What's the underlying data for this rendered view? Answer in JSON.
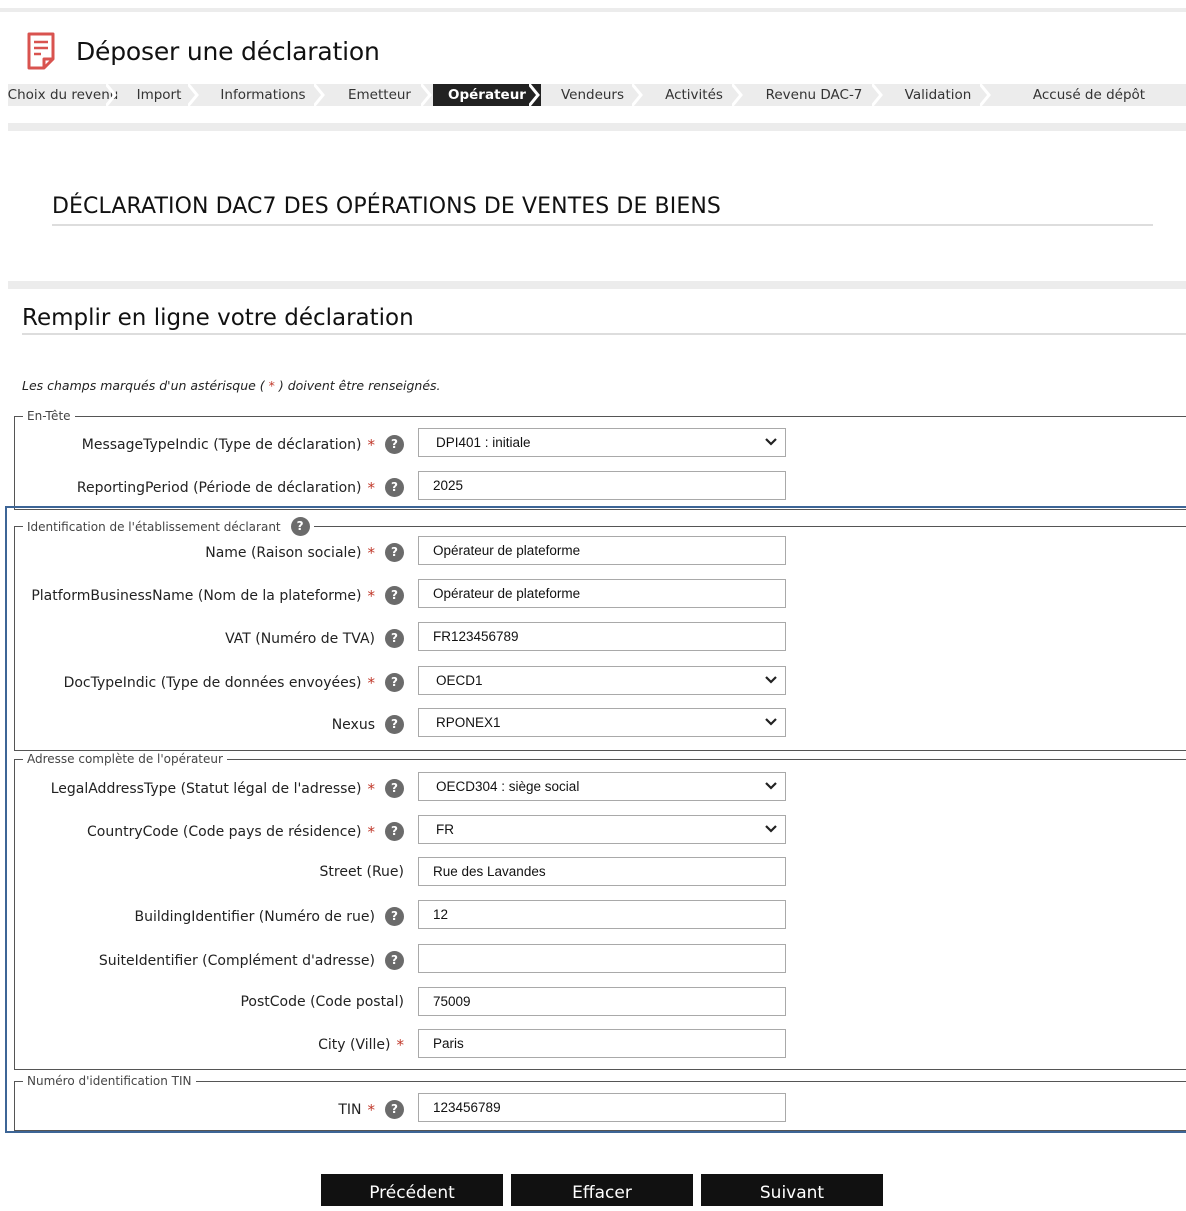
{
  "header": {
    "title": "Déposer une déclaration"
  },
  "steps": [
    {
      "label": "Choix du revenu",
      "active": false
    },
    {
      "label": "Import",
      "active": false
    },
    {
      "label": "Informations",
      "active": false
    },
    {
      "label": "Emetteur",
      "active": false
    },
    {
      "label": "Opérateur",
      "active": true
    },
    {
      "label": "Vendeurs",
      "active": false
    },
    {
      "label": "Activités",
      "active": false
    },
    {
      "label": "Revenu DAC-7",
      "active": false
    },
    {
      "label": "Validation",
      "active": false
    },
    {
      "label": "Accusé de dépôt",
      "active": false
    }
  ],
  "section": {
    "title": "DÉCLARATION DAC7 DES OPÉRATIONS DE VENTES DE BIENS"
  },
  "form": {
    "title": "Remplir en ligne votre déclaration",
    "note_before": "Les champs marqués d'un astérisque ( ",
    "note_star": "*",
    "note_after": " ) doivent être renseignés."
  },
  "groups": {
    "header": {
      "legend": "En-Tête",
      "fields": [
        {
          "label": "MessageTypeIndic (Type de déclaration)",
          "value": "DPI401 : initiale"
        },
        {
          "label": "ReportingPeriod (Période de déclaration)",
          "value": "2025"
        }
      ]
    },
    "identification": {
      "legend": "Identification de l'établissement déclarant",
      "fields": [
        {
          "label": "Name (Raison sociale)",
          "value": "Opérateur de plateforme"
        },
        {
          "label": "PlatformBusinessName (Nom de la plateforme)",
          "value": "Opérateur de plateforme"
        },
        {
          "label": "VAT (Numéro de TVA)",
          "value": "FR123456789"
        },
        {
          "label": "DocTypeIndic (Type de données envoyées)",
          "value": "OECD1"
        },
        {
          "label": "Nexus",
          "value": "RPONEX1"
        }
      ]
    },
    "address": {
      "legend": "Adresse complète de l'opérateur",
      "fields": [
        {
          "label": "LegalAddressType (Statut légal de l'adresse)",
          "value": "OECD304 : siège social"
        },
        {
          "label": "CountryCode (Code pays de résidence)",
          "value": "FR"
        },
        {
          "label": "Street (Rue)",
          "value": "Rue des Lavandes"
        },
        {
          "label": "BuildingIdentifier (Numéro de rue)",
          "value": "12"
        },
        {
          "label": "SuiteIdentifier (Complément d'adresse)",
          "value": ""
        },
        {
          "label": "PostCode (Code postal)",
          "value": "75009"
        },
        {
          "label": "City (Ville)",
          "value": "Paris"
        }
      ]
    },
    "tin": {
      "legend": "Numéro d'identification TIN",
      "fields": [
        {
          "label": "TIN",
          "value": "123456789"
        }
      ]
    }
  },
  "buttons": {
    "previous": "Précédent",
    "clear": "Effacer",
    "next": "Suivant"
  },
  "glyphs": {
    "required": "*",
    "help": "?"
  },
  "colors": {
    "required": "#c0392b",
    "highlight": "#3d6596",
    "active_step": "#222222"
  }
}
